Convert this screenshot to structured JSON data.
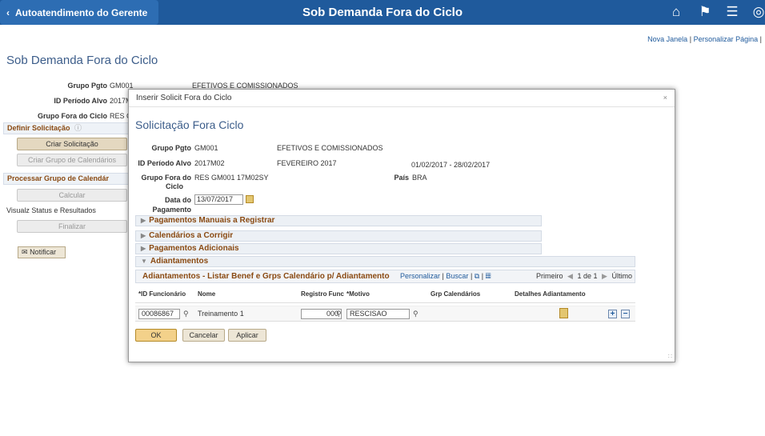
{
  "topbar": {
    "back_label": "Autoatendimento do Gerente",
    "title": "Sob Demanda Fora do Ciclo"
  },
  "links": {
    "new_window": "Nova Janela",
    "separator": "|",
    "personalize": "Personalizar Página"
  },
  "page": {
    "title": "Sob Demanda Fora do Ciclo",
    "grupo_pgto_label": "Grupo Pgto",
    "grupo_pgto_value": "GM001",
    "grupo_pgto_desc": "EFETIVOS E COMISSIONADOS",
    "id_periodo_label": "ID Período Alvo",
    "id_periodo_value": "2017M",
    "grupo_fora_label": "Grupo Fora do Ciclo",
    "grupo_fora_value": "RES C"
  },
  "sidebar": {
    "section1": "Definir Solicitação",
    "criar_solicitacao": "Criar Solicitação",
    "criar_grupo": "Criar Grupo de Calendários",
    "section2": "Processar Grupo de Calendár",
    "calcular": "Calcular",
    "visualz": "Visualz Status e Resultados",
    "finalizar": "Finalizar",
    "notificar": "Notificar"
  },
  "modal": {
    "header": "Inserir Solicit Fora do Ciclo",
    "close": "×",
    "title": "Solicitação Fora Ciclo",
    "grupo_pgto_label": "Grupo Pgto",
    "grupo_pgto_value": "GM001",
    "grupo_pgto_desc": "EFETIVOS E COMISSIONADOS",
    "id_periodo_label": "ID Período Alvo",
    "id_periodo_value": "2017M02",
    "id_periodo_desc": "FEVEREIRO 2017",
    "periodo_range": "01/02/2017 - 28/02/2017",
    "grupo_fora_label_1": "Grupo Fora do",
    "grupo_fora_label_2": "Ciclo",
    "grupo_fora_value": "RES GM001 17M02SY",
    "pais_label": "País",
    "pais_value": "BRA",
    "data_pagamento_label_1": "Data do",
    "data_pagamento_label_2": "Pagamento",
    "data_pagamento_value": "13/07/2017",
    "sections": {
      "manuais": "Pagamentos Manuais a Registrar",
      "calendarios": "Calendários a Corrigir",
      "adicionais": "Pagamentos Adicionais",
      "adiantamentos": "Adiantamentos"
    },
    "grid": {
      "title": "Adiantamentos - Listar Benef e Grps Calendário p/ Adiantamento",
      "personalizar": "Personalizar",
      "buscar": "Buscar",
      "sep": "|",
      "primeiro": "Primeiro",
      "pagination": "1 de 1",
      "ultimo": "Último",
      "headers": {
        "id": "*ID Funcionário",
        "nome": "Nome",
        "registro": "Registro Func",
        "motivo": "*Motivo",
        "grp_cal": "Grp Calendários",
        "detalhes": "Detalhes Adiantamento"
      },
      "row": {
        "id": "00086867",
        "nome": "Treinamento 1",
        "registro": "000",
        "motivo": "RESCISAO"
      }
    },
    "buttons": {
      "ok": "OK",
      "cancelar": "Cancelar",
      "aplicar": "Aplicar"
    }
  },
  "colors": {
    "topbar": "#1f5a9c",
    "section_text": "#8a4a12",
    "title_text": "#3c5d8a"
  }
}
